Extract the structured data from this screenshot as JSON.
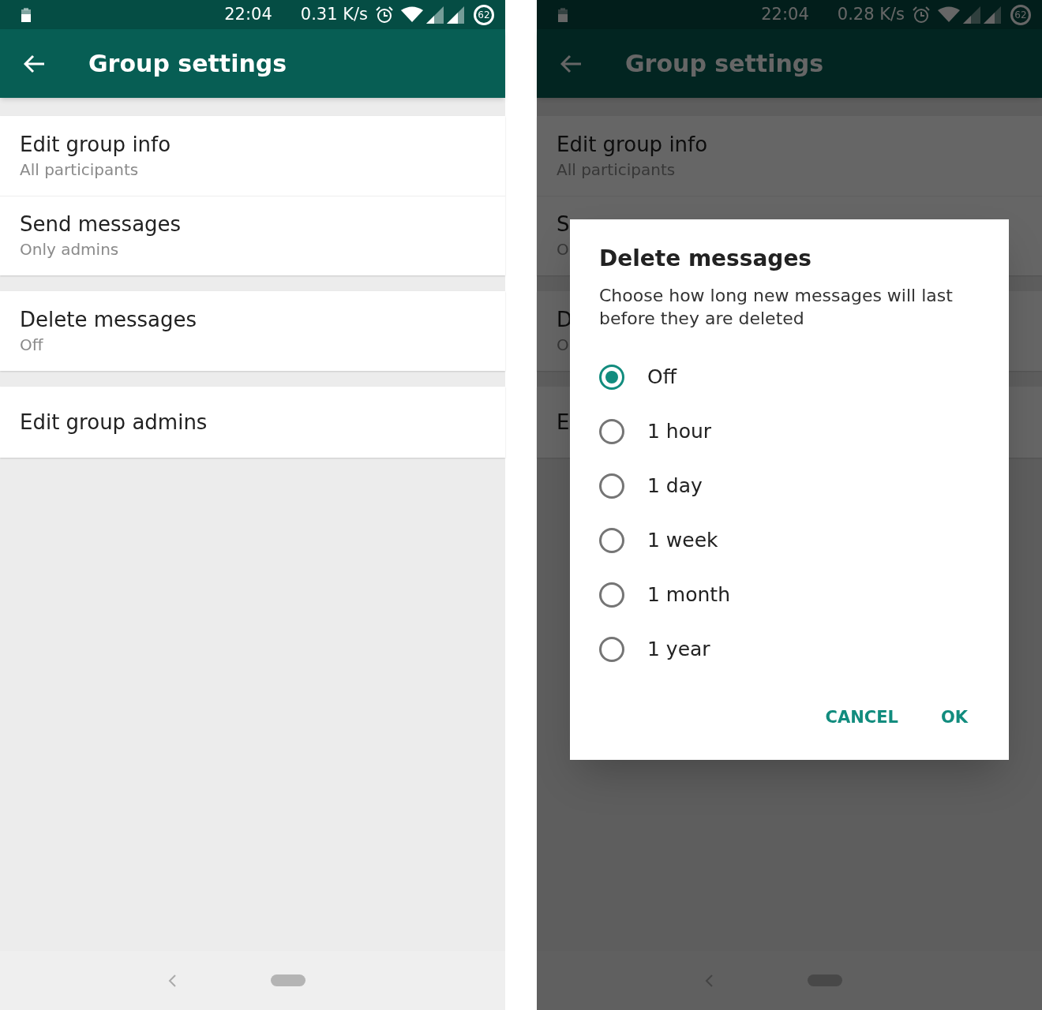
{
  "screens": [
    {
      "dimmed": false,
      "status_bar": {
        "time": "22:04",
        "speed": "0.31 K/s",
        "badge": "62"
      },
      "app_bar": {
        "title": "Group settings"
      },
      "sections": [
        [
          {
            "title": "Edit group info",
            "subtitle": "All participants"
          },
          {
            "title": "Send messages",
            "subtitle": "Only admins"
          }
        ],
        [
          {
            "title": "Delete messages",
            "subtitle": "Off"
          }
        ],
        [
          {
            "title": "Edit group admins"
          }
        ]
      ]
    },
    {
      "dimmed": true,
      "status_bar": {
        "time": "22:04",
        "speed": "0.28 K/s",
        "badge": "62"
      },
      "app_bar": {
        "title": "Group settings"
      },
      "sections": [
        [
          {
            "title": "Edit group info",
            "subtitle": "All participants"
          },
          {
            "title": "S",
            "subtitle": "O"
          }
        ],
        [
          {
            "title": "D",
            "subtitle": "O"
          }
        ],
        [
          {
            "title": "E"
          }
        ]
      ],
      "dialog": {
        "title": "Delete messages",
        "message": "Choose how long new messages will last before they are deleted",
        "options": [
          {
            "label": "Off",
            "selected": true
          },
          {
            "label": "1 hour",
            "selected": false
          },
          {
            "label": "1 day",
            "selected": false
          },
          {
            "label": "1 week",
            "selected": false
          },
          {
            "label": "1 month",
            "selected": false
          },
          {
            "label": "1 year",
            "selected": false
          }
        ],
        "buttons": [
          "CANCEL",
          "OK"
        ]
      }
    }
  ]
}
